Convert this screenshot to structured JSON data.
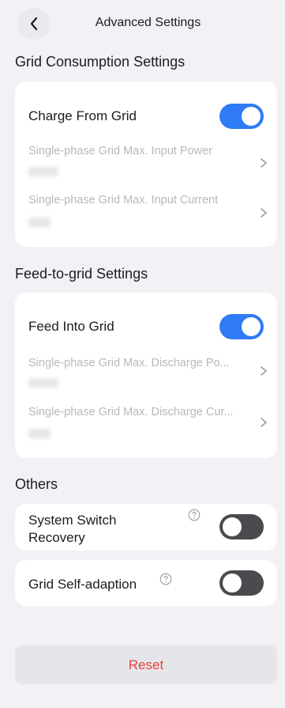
{
  "header": {
    "title": "Advanced Settings",
    "back_icon": "chevron-left-icon"
  },
  "grid_consumption": {
    "section_title": "Grid Consumption Settings",
    "charge_from_grid": {
      "label": "Charge From Grid",
      "enabled": true
    },
    "max_input_power": {
      "label": "Single-phase Grid Max. Input Power",
      "value_state": "blurred"
    },
    "max_input_current": {
      "label": "Single-phase Grid Max. Input Current",
      "value_state": "blurred"
    }
  },
  "feed_to_grid": {
    "section_title": "Feed-to-grid Settings",
    "feed_into_grid": {
      "label": "Feed Into Grid",
      "enabled": true
    },
    "max_discharge_power": {
      "label": "Single-phase Grid Max. Discharge Po...",
      "value_state": "blurred"
    },
    "max_discharge_current": {
      "label": "Single-phase Grid Max. Discharge Cur...",
      "value_state": "blurred"
    }
  },
  "others": {
    "section_title": "Others",
    "system_switch_recovery": {
      "label_line1": "System Switch",
      "label_line2": "Recovery",
      "enabled": false
    },
    "grid_self_adaption": {
      "label": "Grid Self-adaption",
      "enabled": false
    }
  },
  "reset_label": "Reset",
  "colors": {
    "accent": "#2f7bf5",
    "toggle_off": "#4a4a4f",
    "danger": "#e8443a",
    "background": "#f2f2f6"
  }
}
